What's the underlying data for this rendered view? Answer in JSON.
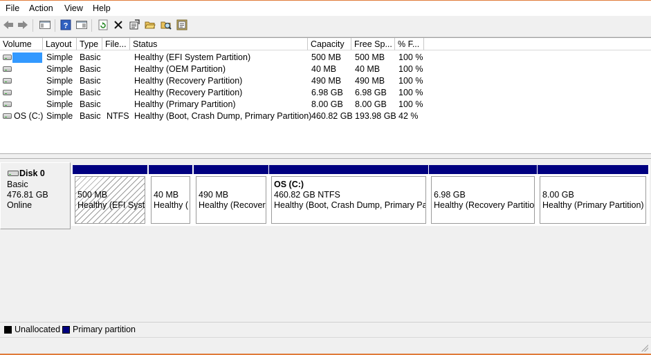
{
  "menu": [
    "File",
    "Action",
    "View",
    "Help"
  ],
  "toolbar": {
    "icons": [
      "back-arrow-icon",
      "forward-arrow-icon",
      "console-tree-icon",
      "help-icon",
      "properties-pane-icon",
      "refresh-icon",
      "delete-icon",
      "properties-icon",
      "open-icon",
      "explore-icon",
      "help-topics-icon"
    ]
  },
  "volume_list": {
    "columns": [
      "Volume",
      "Layout",
      "Type",
      "File...",
      "Status",
      "Capacity",
      "Free Sp...",
      "% F..."
    ],
    "rows": [
      {
        "volume": "",
        "layout": "Simple",
        "type": "Basic",
        "fs": "",
        "status": "Healthy (EFI System Partition)",
        "capacity": "500 MB",
        "free": "500 MB",
        "pct": "100 %"
      },
      {
        "volume": "",
        "layout": "Simple",
        "type": "Basic",
        "fs": "",
        "status": "Healthy (OEM Partition)",
        "capacity": "40 MB",
        "free": "40 MB",
        "pct": "100 %"
      },
      {
        "volume": "",
        "layout": "Simple",
        "type": "Basic",
        "fs": "",
        "status": "Healthy (Recovery Partition)",
        "capacity": "490 MB",
        "free": "490 MB",
        "pct": "100 %"
      },
      {
        "volume": "",
        "layout": "Simple",
        "type": "Basic",
        "fs": "",
        "status": "Healthy (Recovery Partition)",
        "capacity": "6.98 GB",
        "free": "6.98 GB",
        "pct": "100 %"
      },
      {
        "volume": "",
        "layout": "Simple",
        "type": "Basic",
        "fs": "",
        "status": "Healthy (Primary Partition)",
        "capacity": "8.00 GB",
        "free": "8.00 GB",
        "pct": "100 %"
      },
      {
        "volume": "OS (C:)",
        "layout": "Simple",
        "type": "Basic",
        "fs": "NTFS",
        "status": "Healthy (Boot, Crash Dump, Primary Partition)",
        "capacity": "460.82 GB",
        "free": "193.98 GB",
        "pct": "42 %"
      }
    ]
  },
  "disk": {
    "name": "Disk 0",
    "type": "Basic",
    "size": "476.81 GB",
    "state": "Online",
    "partitions": [
      {
        "title": "",
        "size": "500 MB",
        "status": "Healthy (EFI Syste"
      },
      {
        "title": "",
        "size": "40 MB",
        "status": "Healthy ("
      },
      {
        "title": "",
        "size": "490 MB",
        "status": "Healthy (Recovery"
      },
      {
        "title": "OS  (C:)",
        "size": "460.82 GB NTFS",
        "status": "Healthy (Boot, Crash Dump, Primary Part"
      },
      {
        "title": "",
        "size": "6.98 GB",
        "status": "Healthy (Recovery Partitior"
      },
      {
        "title": "",
        "size": "8.00 GB",
        "status": "Healthy (Primary Partition)"
      }
    ]
  },
  "legend": [
    {
      "label": "Unallocated",
      "color": "#000000"
    },
    {
      "label": "Primary partition",
      "color": "#000080"
    }
  ]
}
